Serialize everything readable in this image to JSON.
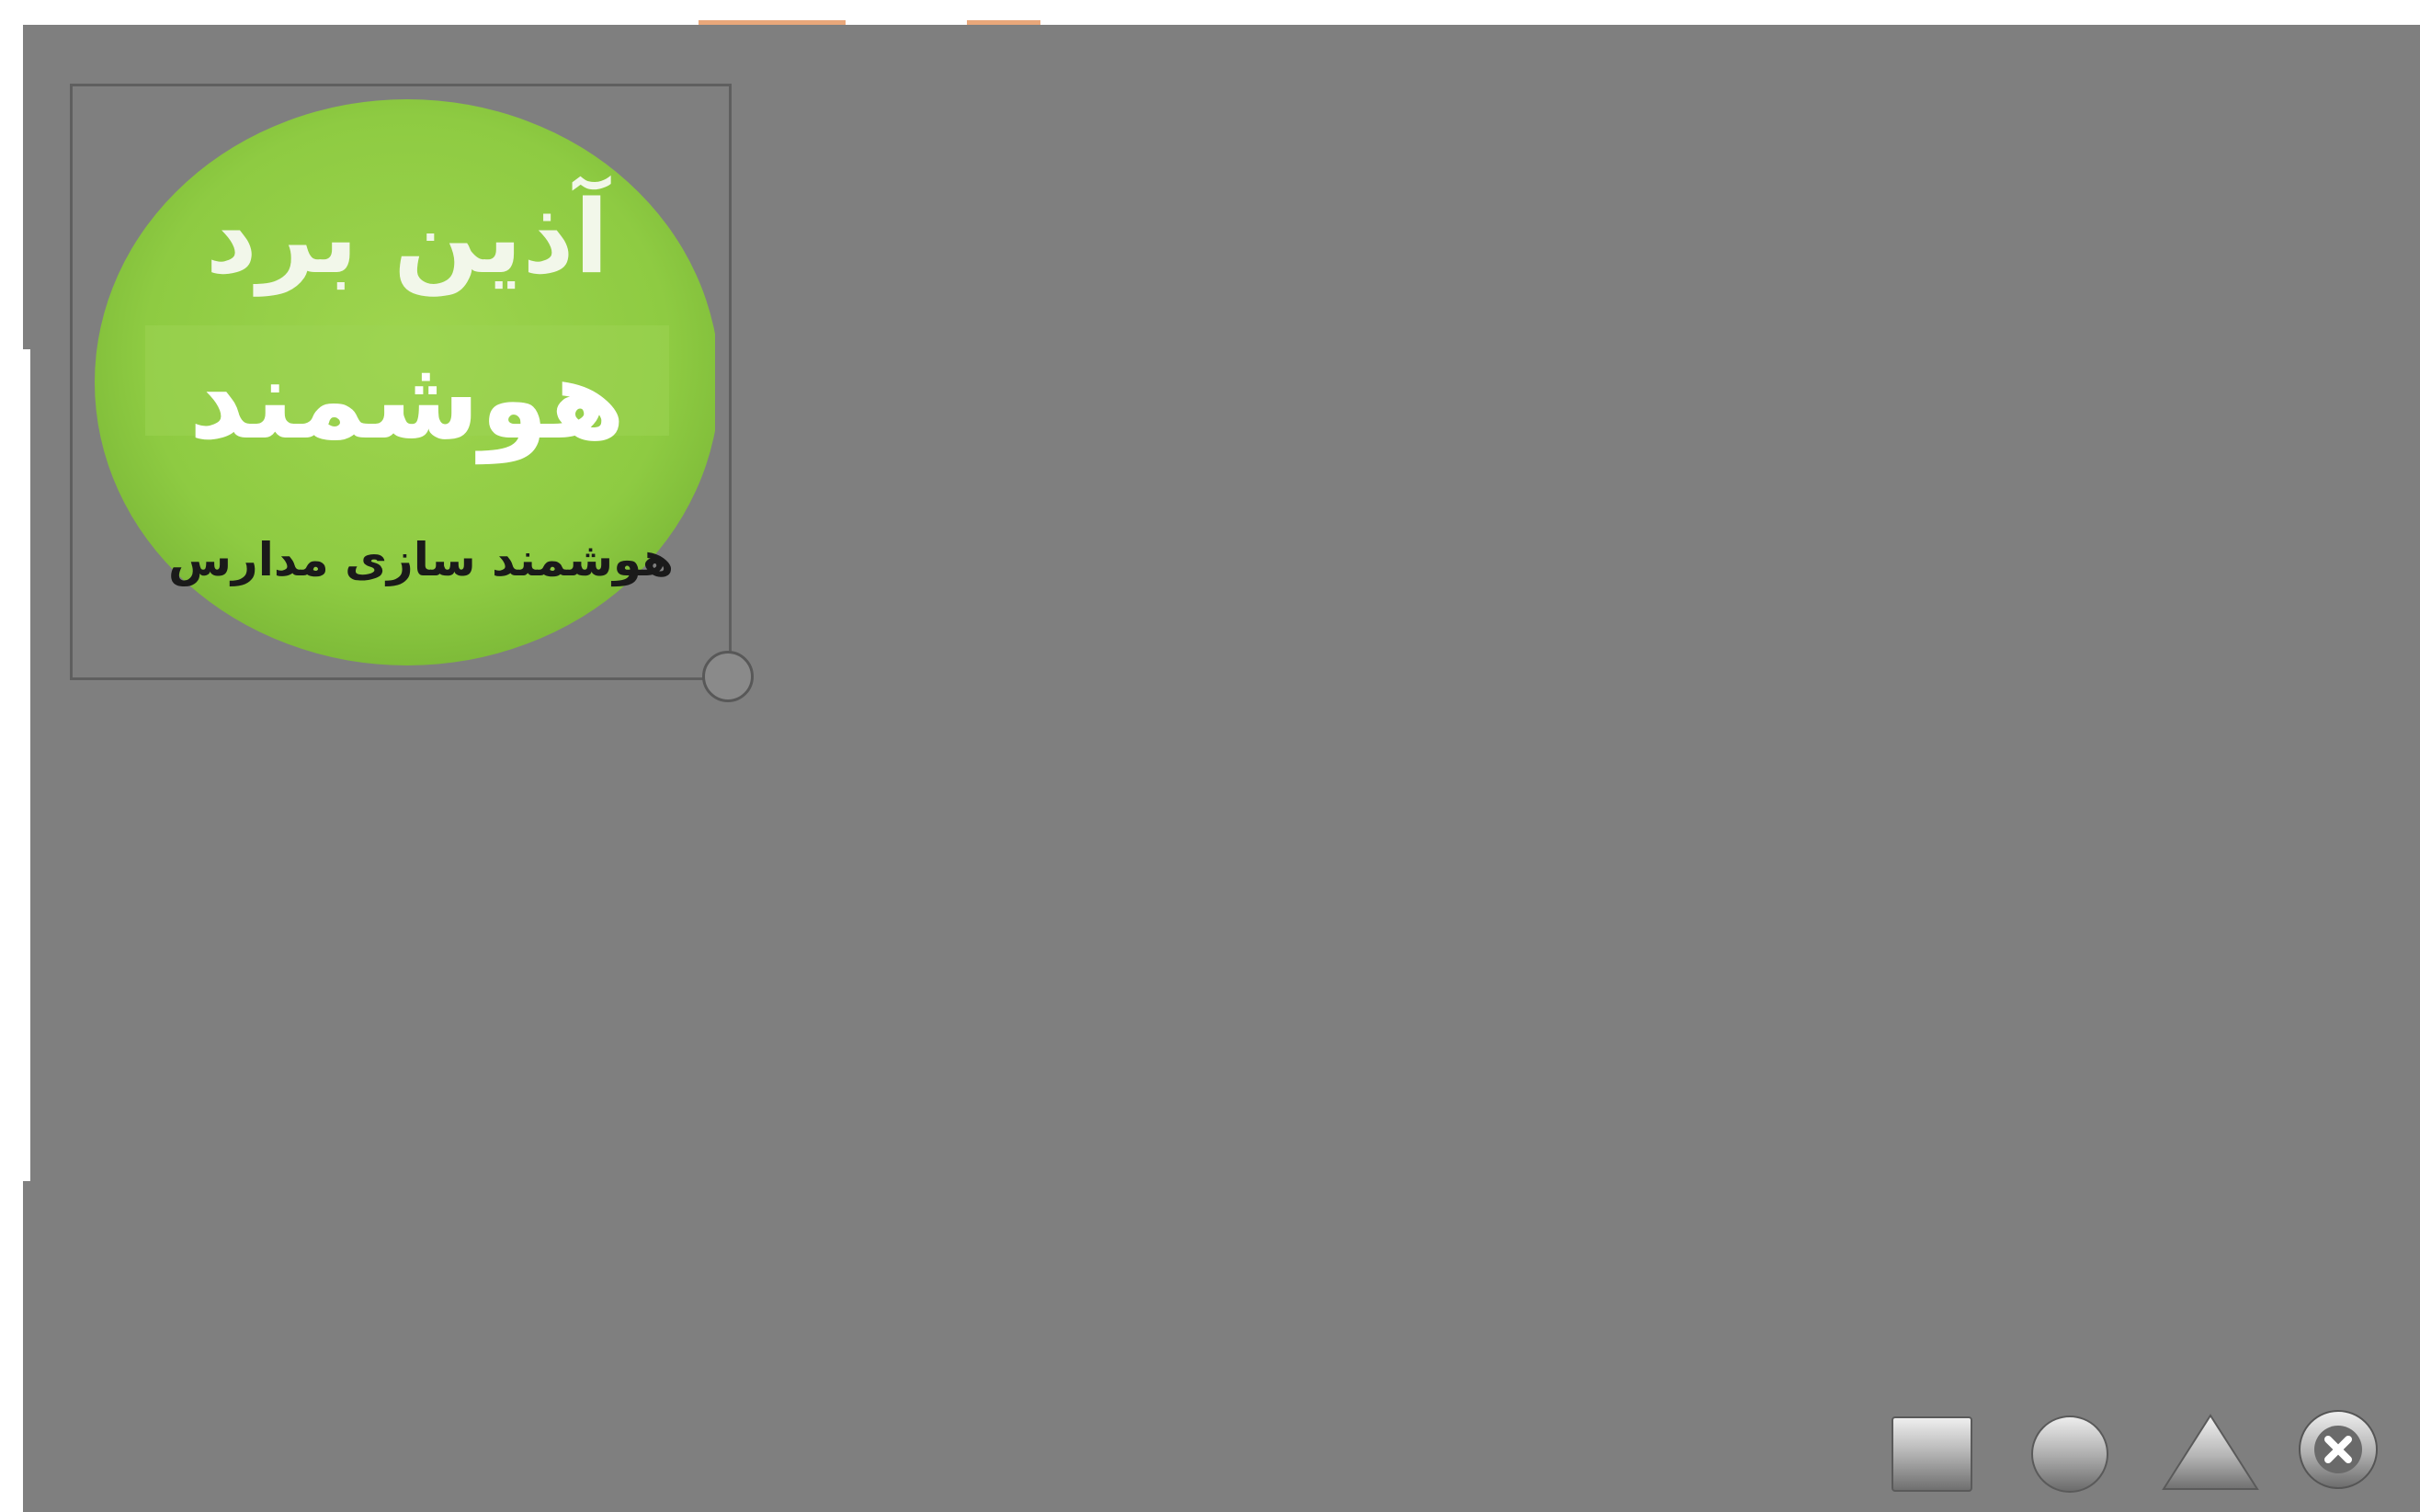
{
  "logo": {
    "line1": "آذین برد",
    "line2": "هوشمند",
    "line3": "هوشمند سازی مدارس"
  },
  "toolbar": {
    "tools": [
      {
        "name": "square-shape-icon",
        "icon": "square"
      },
      {
        "name": "circle-shape-icon",
        "icon": "circle"
      },
      {
        "name": "triangle-shape-icon",
        "icon": "triangle"
      },
      {
        "name": "close-icon",
        "icon": "close"
      }
    ]
  },
  "colors": {
    "canvas": "#7f7f7f",
    "logo_green": "#8ecb42",
    "accent": "#e2894d"
  }
}
